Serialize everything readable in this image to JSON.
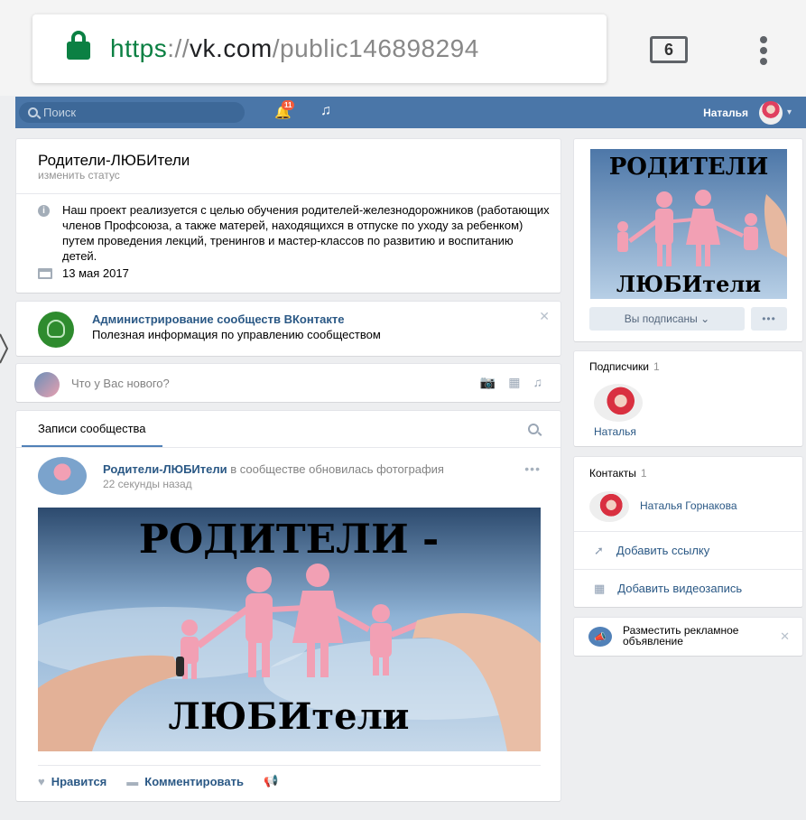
{
  "browser": {
    "url": {
      "scheme": "https",
      "sep": "://",
      "host": "vk.com",
      "path": "/public146898294"
    },
    "tab_count": "6"
  },
  "vk_header": {
    "search_placeholder": "Поиск",
    "notifications_count": "11",
    "user_name": "Наталья"
  },
  "community": {
    "name": "Родители-ЛЮБИтели",
    "status_link": "изменить статус",
    "description": "Наш проект реализуется с целью обучения родителей-железнодорожников (работающих членов Профсоюза, а также матерей, находящихся в отпуске по уходу за ребенком) путем проведения лекций, тренингов и мастер-классов по развитию и воспитанию детей.",
    "created_date": "13 мая 2017"
  },
  "admin_banner": {
    "title": "Администрирование сообществ ВКонтакте",
    "subtitle": "Полезная информация по управлению сообществом",
    "close": "✕"
  },
  "composer": {
    "placeholder": "Что у Вас нового?"
  },
  "wall": {
    "tab_label": "Записи сообщества",
    "post": {
      "author": "Родители-ЛЮБИтели",
      "action": " в сообществе обновилась фотография",
      "time": "22 секунды назад",
      "more": "•••",
      "image_text_top": "РОДИТЕЛИ -",
      "image_text_bottom": "ЛЮБИтели",
      "like_label": "Нравится",
      "comment_label": "Комментировать"
    }
  },
  "cover": {
    "image_text_top": "РОДИТЕЛИ",
    "image_text_bottom": "ЛЮБИтели",
    "subscribed_label": "Вы подписаны ⌄",
    "more": "•••"
  },
  "subscribers": {
    "heading": "Подписчики",
    "count": "1",
    "items": [
      {
        "name": "Наталья"
      }
    ]
  },
  "contacts": {
    "heading": "Контакты",
    "count": "1",
    "person": "Наталья Горнакова",
    "add_link": "Добавить ссылку",
    "add_video": "Добавить видеозапись"
  },
  "ads": {
    "text": "Разместить рекламное объявление",
    "close": "✕"
  },
  "colors": {
    "vk_blue": "#4a76a8",
    "link": "#2a5885",
    "secure_green": "#0b8043",
    "poster_pink": "#e8336f"
  }
}
